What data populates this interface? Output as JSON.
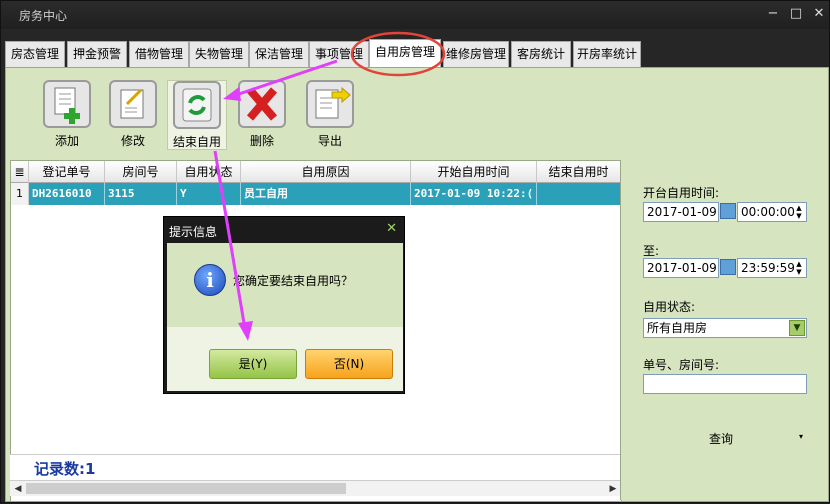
{
  "window": {
    "title": "房务中心",
    "minimize": "−",
    "maximize": "□",
    "close": "✕"
  },
  "tabs": [
    {
      "label": "房态管理"
    },
    {
      "label": "押金预警"
    },
    {
      "label": "借物管理"
    },
    {
      "label": "失物管理"
    },
    {
      "label": "保洁管理"
    },
    {
      "label": "事项管理"
    },
    {
      "label": "自用房管理"
    },
    {
      "label": "维修房管理"
    },
    {
      "label": "客房统计"
    },
    {
      "label": "开房率统计"
    }
  ],
  "toolbar": [
    {
      "label": "添加",
      "icon": "add-document-icon"
    },
    {
      "label": "修改",
      "icon": "edit-document-icon"
    },
    {
      "label": "结束自用",
      "icon": "refresh-icon"
    },
    {
      "label": "删除",
      "icon": "delete-x-icon"
    },
    {
      "label": "导出",
      "icon": "export-icon"
    }
  ],
  "grid": {
    "columns": [
      "登记单号",
      "房间号",
      "自用状态",
      "自用原因",
      "开始自用时间",
      "结束自用时"
    ],
    "rows": [
      {
        "num": "1",
        "cells": [
          "DH2616010",
          "3115",
          "Y",
          "员工自用",
          "2017-01-09 10:22:(",
          ""
        ]
      }
    ],
    "record_count": "记录数:1"
  },
  "panel": {
    "start_label": "开台自用时间:",
    "start_date": "2017-01-09",
    "start_time": "00:00:00",
    "to_label": "至:",
    "end_date": "2017-01-09",
    "end_time": "23:59:59",
    "status_label": "自用状态:",
    "status_value": "所有自用房",
    "search_label": "单号、房间号:",
    "search_value": "",
    "query_label": "查询",
    "query_arrow": "▾"
  },
  "dialog": {
    "title": "提示信息",
    "close": "✕",
    "icon_glyph": "i",
    "message": "您确定要结束自用吗？",
    "yes_label": "是(Y)",
    "no_label": "否(N)"
  },
  "colors": {
    "accent": "#2aa1b8",
    "panel_bg": "#d6e4bf",
    "annotation": "#e040fb",
    "highlight_circle": "#e0443a"
  }
}
